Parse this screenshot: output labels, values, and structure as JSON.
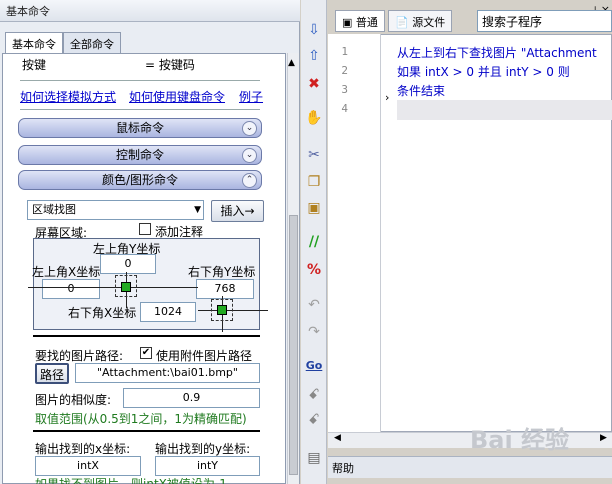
{
  "panel": {
    "title": "基本命令",
    "pin": "ᵖ",
    "close": "×"
  },
  "tabs": [
    "基本命令",
    "全部命令"
  ],
  "row_keys": {
    "key_label": "按键",
    "keycode_label": "= 按键码"
  },
  "links": [
    "如何选择模拟方式",
    "如何使用键盘命令",
    "例子"
  ],
  "sections": [
    "鼠标命令",
    "控制命令",
    "颜色/图形命令"
  ],
  "select": {
    "value": "区域找图",
    "insert": "插入→"
  },
  "screen": {
    "label": "屏幕区域:",
    "comment_label": "添加注释"
  },
  "coords": {
    "top_y_label": "左上角Y坐标",
    "top_y": "0",
    "left_x_label": "左上角X坐标",
    "left_x": "0",
    "right_y_label": "右下角Y坐标",
    "right_y": "768",
    "right_x_label": "右下角X坐标",
    "right_x": "1024"
  },
  "image": {
    "label": "要找的图片路径:",
    "use_attach": "使用附件图片路径",
    "path_btn": "路径",
    "path_value": "\"Attachment:\\bai01.bmp\"",
    "similar_label": "图片的相似度:",
    "similar_value": "0.9",
    "range_note": "取值范围(从0.5到1之间，1为精确匹配)"
  },
  "output": {
    "x_label": "输出找到的x坐标:",
    "y_label": "输出找到的y坐标:",
    "x_var": "intX",
    "y_var": "intY",
    "bottom_note": "如果找不到图片，则intX被值设为-1"
  },
  "editor": {
    "tab_normal": "普通",
    "tab_source": "源文件",
    "search": "搜索子程序",
    "lines": [
      "1",
      "2",
      "3",
      "4"
    ],
    "code": [
      "从左上到右下查找图片 \"Attachment",
      "如果 intX > 0 并且 intY > 0 则",
      "条件结束"
    ],
    "help": "帮助"
  }
}
